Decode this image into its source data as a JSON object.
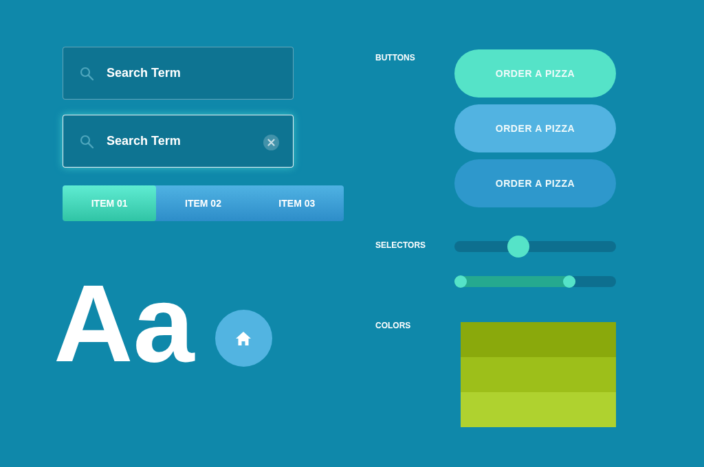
{
  "search_fields": [
    {
      "value": "Search Term",
      "focused": false
    },
    {
      "value": "Search Term",
      "focused": true
    }
  ],
  "tabs": [
    {
      "label": "ITEM 01",
      "selected": true
    },
    {
      "label": "ITEM 02",
      "selected": false
    },
    {
      "label": "ITEM 03",
      "selected": false
    }
  ],
  "type_sample": "Aa",
  "sections": [
    {
      "kind": "buttons",
      "label": "BUTTONS",
      "buttons": [
        {
          "label": "ORDER A PIZZA",
          "color": "#55e3c8"
        },
        {
          "label": "ORDER A PIZZA",
          "color": "#52b3e1"
        },
        {
          "label": "ORDER A PIZZA",
          "color": "#2e98cc"
        }
      ]
    },
    {
      "kind": "selectors",
      "label": "SELECTORS",
      "sliders": [
        {
          "kind": "single",
          "level": 0.38
        },
        {
          "kind": "range",
          "level": 0.73
        }
      ]
    },
    {
      "kind": "colors",
      "label": "COLORS",
      "swatches": [
        {
          "color": "#8aa90c"
        },
        {
          "color": "#9dbf1a"
        },
        {
          "color": "#afd22f"
        }
      ]
    }
  ]
}
